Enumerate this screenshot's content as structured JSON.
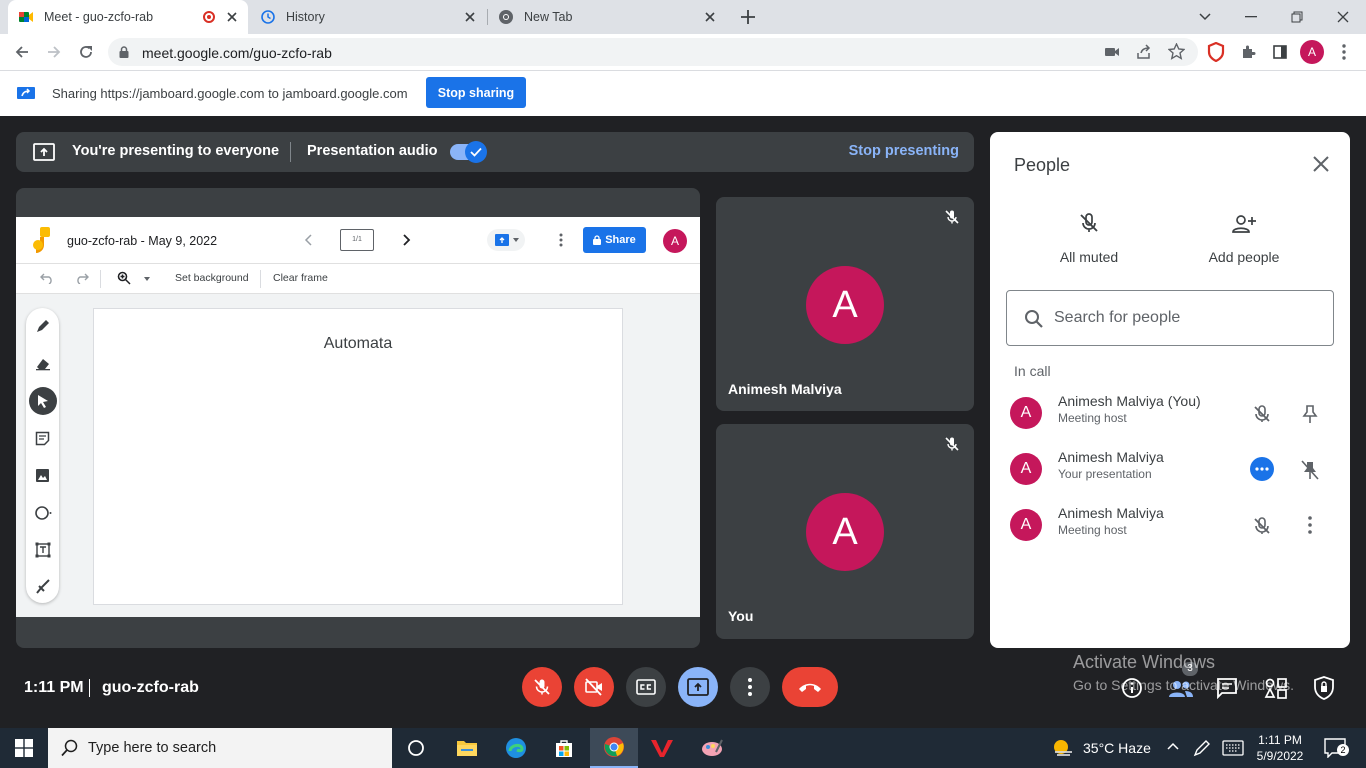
{
  "browser": {
    "tabs": [
      {
        "title": "Meet - guo-zcfo-rab",
        "icon": "meet-icon",
        "active": true
      },
      {
        "title": "History",
        "icon": "history-icon",
        "active": false
      },
      {
        "title": "New Tab",
        "icon": "chrome-icon",
        "active": false
      }
    ],
    "url": "meet.google.com/guo-zcfo-rab",
    "profile_initial": "A"
  },
  "share_bar": {
    "text": "Sharing https://jamboard.google.com to jamboard.google.com",
    "button": "Stop sharing"
  },
  "presenting_bar": {
    "message": "You're presenting to everyone",
    "audio_label": "Presentation audio",
    "audio_on": true,
    "stop_label": "Stop presenting"
  },
  "jamboard": {
    "title": "guo-zcfo-rab - May 9, 2022",
    "frame_counter": "1/1",
    "share_label": "Share",
    "avatar_initial": "A",
    "tools": {
      "set_background": "Set background",
      "clear_frame": "Clear frame"
    },
    "frame_text": "Automata"
  },
  "tiles": [
    {
      "name": "Animesh Malviya",
      "initial": "A",
      "muted": true
    },
    {
      "name": "You",
      "initial": "A",
      "muted": true
    }
  ],
  "people_panel": {
    "title": "People",
    "all_muted_label": "All muted",
    "add_people_label": "Add people",
    "search_placeholder": "Search for people",
    "section_label": "In call",
    "participants": [
      {
        "name": "Animesh Malviya (You)",
        "subtitle": "Meeting host",
        "initial": "A"
      },
      {
        "name": "Animesh Malviya",
        "subtitle": "Your presentation",
        "initial": "A"
      },
      {
        "name": "Animesh Malviya",
        "subtitle": "Meeting host",
        "initial": "A"
      }
    ]
  },
  "meeting_bar": {
    "time": "1:11 PM",
    "code": "guo-zcfo-rab",
    "people_count": "3"
  },
  "watermark": {
    "line1": "Activate Windows",
    "line2": "Go to Settings to activate Windows."
  },
  "taskbar": {
    "search_placeholder": "Type here to search",
    "weather": "35°C  Haze",
    "time": "1:11 PM",
    "date": "5/9/2022",
    "notification_count": "2"
  },
  "colors": {
    "accent": "#1a73e8",
    "avatar": "#c5175b",
    "danger": "#ea4335",
    "meet_bg": "#202124",
    "tile_bg": "#3c4043"
  }
}
